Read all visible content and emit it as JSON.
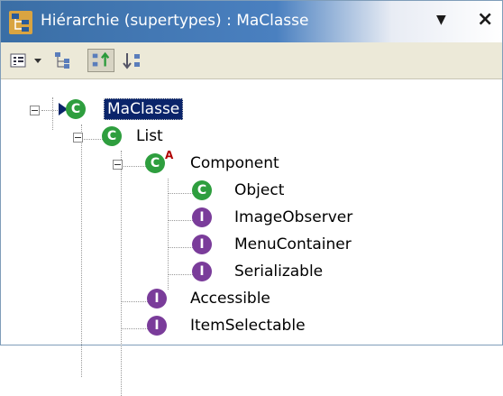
{
  "window": {
    "title": "Hiérarchie (supertypes) : MaClasse",
    "dropdown_glyph": "▼",
    "close_glyph": "×"
  },
  "icons": {
    "title": "type-hierarchy-icon",
    "class_letter": "C",
    "interface_letter": "I",
    "abstract_marker": "A"
  },
  "colors": {
    "class_icon": "#2e9e3e",
    "interface_icon": "#7a3c9a",
    "selection": "#0a246a"
  },
  "tree": {
    "root": "MaClasse",
    "list": "List",
    "component": "Component",
    "object": "Object",
    "image_observer": "ImageObserver",
    "menu_container": "MenuContainer",
    "serializable": "Serializable",
    "accessible": "Accessible",
    "item_selectable": "ItemSelectable"
  }
}
